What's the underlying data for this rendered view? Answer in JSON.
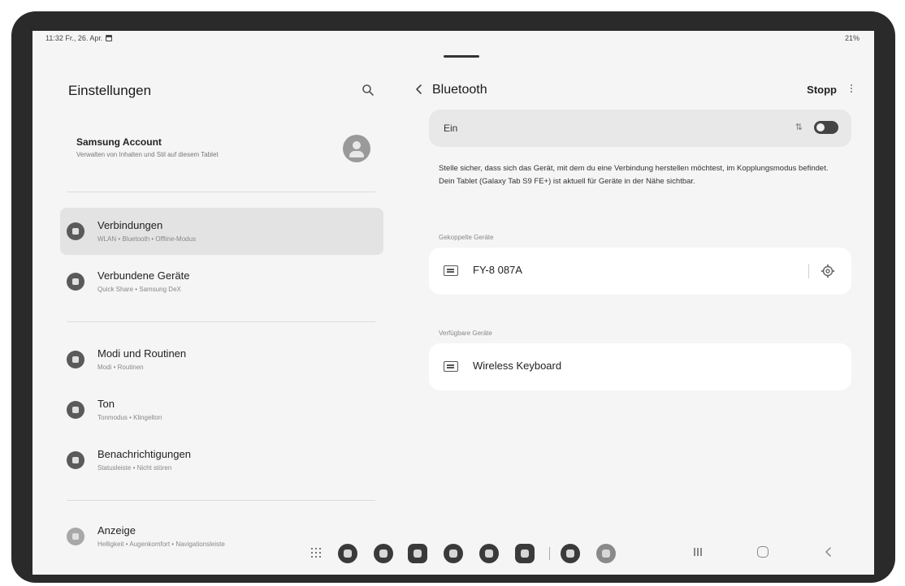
{
  "status_bar": {
    "time_date": "11:32 Fr., 26. Apr.",
    "battery": "21%"
  },
  "left_pane": {
    "title": "Einstellungen",
    "search_icon": "search-icon",
    "account": {
      "title": "Samsung Account",
      "subtitle": "Verwalten von Inhalten und Stil auf diesem Tablet"
    },
    "items": [
      {
        "label": "Verbindungen",
        "sub": "WLAN • Bluetooth • Offline-Modus",
        "icon": "wifi-icon",
        "selected": true
      },
      {
        "label": "Verbundene Geräte",
        "sub": "Quick Share • Samsung DeX",
        "icon": "connected-devices-icon",
        "selected": false
      },
      {
        "label": "Modi und Routinen",
        "sub": "Modi • Routinen",
        "icon": "modes-icon",
        "selected": false
      },
      {
        "label": "Ton",
        "sub": "Tonmodus • Klingelton",
        "icon": "sound-icon",
        "selected": false
      },
      {
        "label": "Benachrichtigungen",
        "sub": "Statusleiste • Nicht stören",
        "icon": "notifications-icon",
        "selected": false
      },
      {
        "label": "Anzeige",
        "sub": "Helligkeit • Augenkomfort • Navigationsleiste",
        "icon": "display-icon",
        "selected": false
      }
    ]
  },
  "right_pane": {
    "title": "Bluetooth",
    "stop_label": "Stopp",
    "toggle": {
      "label": "Ein",
      "extra": "⇅",
      "on": true
    },
    "info": "Stelle sicher, dass sich das Gerät, mit dem du eine Verbindung herstellen möchtest, im Kopplungsmodus befindet. Dein Tablet (Galaxy Tab S9 FE+) ist aktuell für Geräte in der Nähe sichtbar.",
    "paired_section": "Gekoppelte Geräte",
    "paired_devices": [
      {
        "name": "FY-8 087A",
        "icon": "keyboard-icon"
      }
    ],
    "available_section": "Verfügbare Geräte",
    "available_devices": [
      {
        "name": "Wireless Keyboard",
        "icon": "keyboard-icon"
      }
    ]
  },
  "dock": {
    "apps": [
      "chat-app-icon",
      "settings-app-icon",
      "calendar-app-icon",
      "gallery-app-icon",
      "contacts-app-icon",
      "camera-app-icon",
      "store-app-icon",
      "search-app-icon"
    ],
    "nav": [
      "recents-icon",
      "home-icon",
      "back-icon"
    ]
  },
  "colors": {
    "background": "#f5f5f5",
    "selected_item": "#e3e3e3",
    "card": "#ffffff",
    "toggle_card": "#e8e8e8",
    "switch_on": "#444444"
  }
}
